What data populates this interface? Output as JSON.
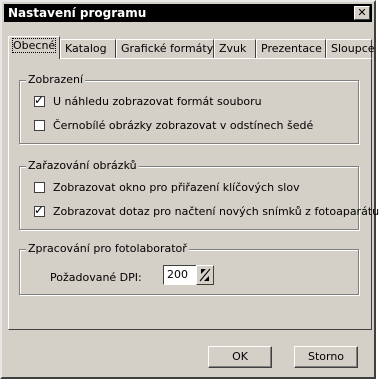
{
  "window": {
    "title": "Nastavení programu",
    "close_glyph": "✕"
  },
  "tabs": [
    {
      "label": "Obecné"
    },
    {
      "label": "Katalog"
    },
    {
      "label": "Grafické formáty"
    },
    {
      "label": "Zvuk"
    },
    {
      "label": "Prezentace"
    },
    {
      "label": "Sloupce"
    }
  ],
  "groups": {
    "zobrazeni": {
      "title": "Zobrazení",
      "options": [
        {
          "label": "U náhledu zobrazovat formát souboru",
          "checked": true
        },
        {
          "label": "Černobílé obrázky zobrazovat v odstínech šedé",
          "checked": false
        }
      ]
    },
    "zarazovani": {
      "title": "Zařazování obrázků",
      "options": [
        {
          "label": "Zobrazovat okno pro přiřazení klíčových slov",
          "checked": false
        },
        {
          "label": "Zobrazovat dotaz pro načtení nových snímků z fotoaparátu",
          "checked": true
        }
      ]
    },
    "fotolab": {
      "title": "Zpracování pro fotolaboratoř",
      "dpi_label": "Požadované DPI:",
      "dpi_value": "200"
    }
  },
  "buttons": {
    "ok": "OK",
    "cancel": "Storno"
  },
  "colors": {
    "face": "#d4d0c8",
    "titlebar": "#000000"
  }
}
